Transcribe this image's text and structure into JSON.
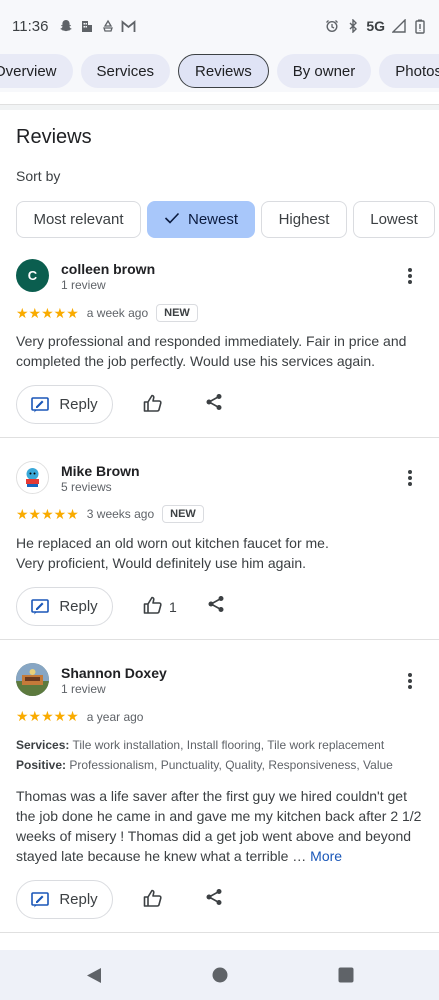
{
  "status_bar": {
    "time": "11:36",
    "network": "5G"
  },
  "tabs": [
    {
      "label": "Overview",
      "active": false
    },
    {
      "label": "Services",
      "active": false
    },
    {
      "label": "Reviews",
      "active": true
    },
    {
      "label": "By owner",
      "active": false
    },
    {
      "label": "Photos",
      "active": false
    }
  ],
  "section": {
    "title": "Reviews",
    "sort_label": "Sort by"
  },
  "sort_chips": [
    {
      "label": "Most relevant",
      "selected": false
    },
    {
      "label": "Newest",
      "selected": true
    },
    {
      "label": "Highest",
      "selected": false
    },
    {
      "label": "Lowest",
      "selected": false
    }
  ],
  "reviews": [
    {
      "avatar_letter": "C",
      "avatar_color": "#0b5e4f",
      "name": "colleen brown",
      "count": "1 review",
      "stars": "★★★★★",
      "rating": 5,
      "date": "a week ago",
      "badge": "NEW",
      "text": "Very professional and responded immediately. Fair in price and completed the job perfectly. Would use his services again.",
      "reply_label": "Reply",
      "like_count": ""
    },
    {
      "avatar_letter": "",
      "avatar_color": "#ffffff",
      "name": "Mike Brown",
      "count": "5 reviews",
      "stars": "★★★★★",
      "rating": 5,
      "date": "3 weeks ago",
      "badge": "NEW",
      "text": "He replaced an old worn out kitchen faucet for me. Very proficient, Would definitely use him again.",
      "reply_label": "Reply",
      "like_count": "1"
    },
    {
      "avatar_letter": "",
      "avatar_color": "#6b7f5a",
      "name": "Shannon Doxey",
      "count": "1 review",
      "stars": "★★★★★",
      "rating": 5,
      "date": "a year ago",
      "badge": "",
      "services_label": "Services:",
      "services": "Tile work installation, Install flooring, Tile work replacement",
      "positive_label": "Positive:",
      "positive": "Professionalism, Punctuality, Quality, Responsiveness, Value",
      "text": "Thomas was a life saver after the first guy we hired couldn't get the job done he came in and gave me my kitchen back after 2 1/2 weeks of misery ! Thomas did a get job went above and beyond stayed late because he knew what a terrible …",
      "more_label": "More",
      "reply_label": "Reply",
      "like_count": ""
    }
  ],
  "colors": {
    "accent": "#a8c7fa",
    "star": "#f9ab00",
    "link": "#1a57b8"
  }
}
